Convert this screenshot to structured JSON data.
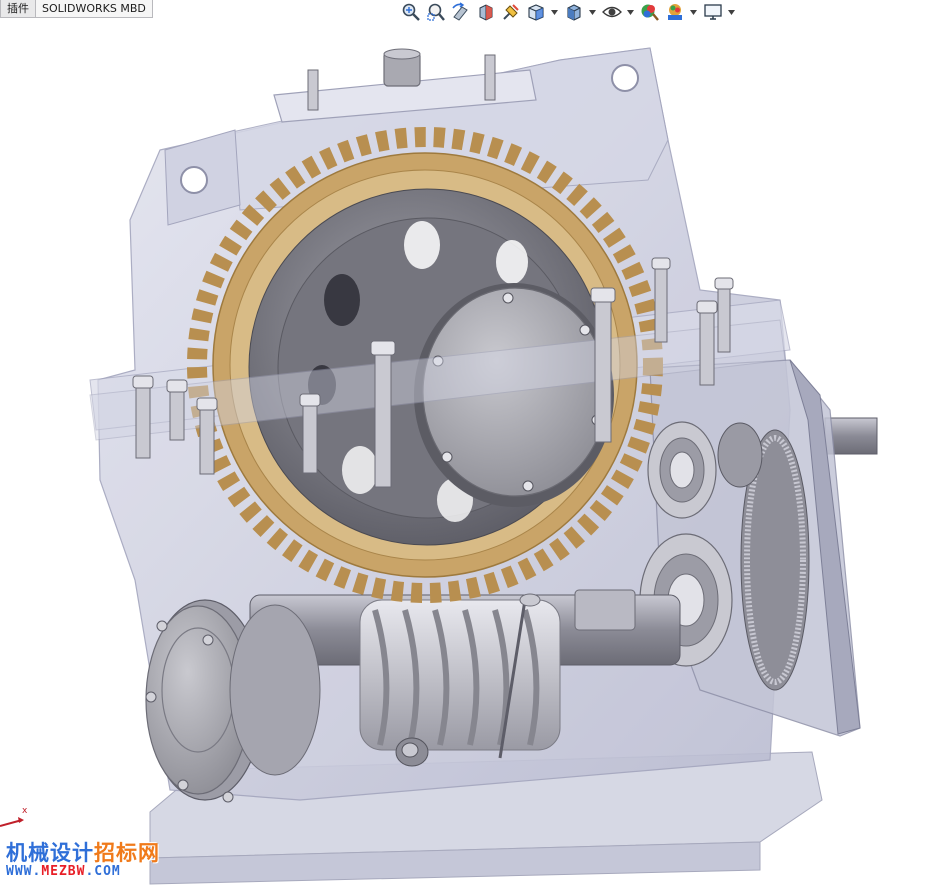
{
  "tabs": [
    {
      "label": "插件",
      "active": false
    },
    {
      "label": "SOLIDWORKS MBD",
      "active": true
    }
  ],
  "hud": {
    "buttons": [
      {
        "name": "zoom-to-fit-icon",
        "has_menu": false
      },
      {
        "name": "zoom-to-area-icon",
        "has_menu": false
      },
      {
        "name": "previous-view-icon",
        "has_menu": false
      },
      {
        "name": "section-view-icon",
        "has_menu": false
      },
      {
        "name": "dynamic-annotation-icon",
        "has_menu": false
      },
      {
        "name": "view-orientation-icon",
        "has_menu": true
      },
      {
        "name": "display-style-icon",
        "has_menu": true
      },
      {
        "name": "hide-show-items-icon",
        "has_menu": true
      },
      {
        "name": "edit-appearance-icon",
        "has_menu": false
      },
      {
        "name": "apply-scene-icon",
        "has_menu": true
      },
      {
        "name": "view-settings-icon",
        "has_menu": true
      }
    ]
  },
  "triad": {
    "axis_label": "x"
  },
  "watermark": {
    "part1": "机械设计",
    "part2": "招标网",
    "url_part1": "WWW.",
    "url_part2": "MEZBW",
    "url_part3": ".COM"
  },
  "colors": {
    "housing": "#c4c6d8",
    "gear_bronze": "#c9a468",
    "steel": "#8d8d95",
    "accent_blue": "#2f6fd8",
    "accent_orange": "#f07a1a"
  }
}
